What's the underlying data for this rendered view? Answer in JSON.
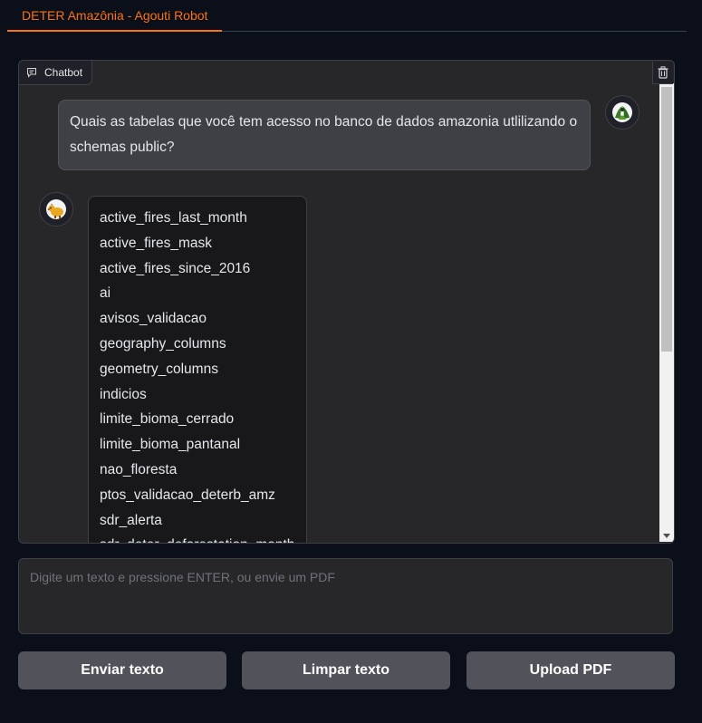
{
  "tabs": [
    {
      "label": "DETER Amazônia - Agouti Robot"
    }
  ],
  "chatbot": {
    "label": "Chatbot",
    "label_icon": "chat-icon",
    "clear_icon": "trash-icon",
    "user_message": "Quais as tabelas que você tem acesso no banco de dados amazonia utlilizando o schemas public?",
    "bot_items": [
      "active_fires_last_month",
      "active_fires_mask",
      "active_fires_since_2016",
      "ai",
      "avisos_validacao",
      "geography_columns",
      "geometry_columns",
      "indicios",
      "limite_bioma_cerrado",
      "limite_bioma_pantanal",
      "nao_floresta",
      "ptos_validacao_deterb_amz",
      "sdr_alerta",
      "sdr_deter_deforestation_month"
    ]
  },
  "input": {
    "placeholder": "Digite um texto e pressione ENTER, ou envie um PDF",
    "value": ""
  },
  "buttons": {
    "send": "Enviar texto",
    "clear": "Limpar texto",
    "upload": "Upload PDF"
  },
  "colors": {
    "accent": "#f97316",
    "background": "#0b0f19",
    "panel": "#27272a",
    "button": "#52525b"
  }
}
